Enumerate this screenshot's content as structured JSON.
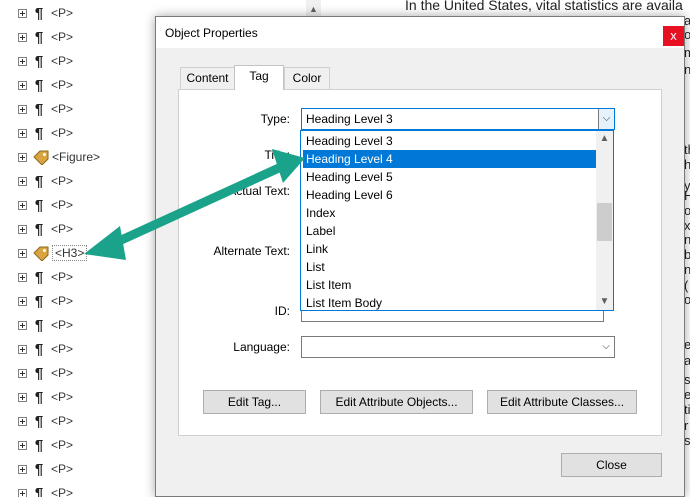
{
  "tree": {
    "items": [
      {
        "type": "p",
        "label": "<P>"
      },
      {
        "type": "p",
        "label": "<P>"
      },
      {
        "type": "p",
        "label": "<P>"
      },
      {
        "type": "p",
        "label": "<P>"
      },
      {
        "type": "p",
        "label": "<P>"
      },
      {
        "type": "p",
        "label": "<P>"
      },
      {
        "type": "tag",
        "label": "<Figure>"
      },
      {
        "type": "p",
        "label": "<P>"
      },
      {
        "type": "p",
        "label": "<P>"
      },
      {
        "type": "p",
        "label": "<P>"
      },
      {
        "type": "tag",
        "label": "<H3>"
      },
      {
        "type": "p",
        "label": "<P>"
      },
      {
        "type": "p",
        "label": "<P>"
      },
      {
        "type": "p",
        "label": "<P>"
      },
      {
        "type": "p",
        "label": "<P>"
      },
      {
        "type": "p",
        "label": "<P>"
      },
      {
        "type": "p",
        "label": "<P>"
      },
      {
        "type": "p",
        "label": "<P>"
      },
      {
        "type": "p",
        "label": "<P>"
      },
      {
        "type": "p",
        "label": "<P>"
      },
      {
        "type": "p",
        "label": "<P>"
      }
    ]
  },
  "document": {
    "text_line": "In the United States, vital statistics are availa",
    "fragments": [
      "a",
      "o",
      "m",
      "n",
      "th",
      "h",
      "y",
      "He",
      "o",
      "xt",
      "n",
      "be",
      "ny",
      "(",
      "or",
      "e",
      "a",
      "s",
      "e",
      "ti",
      "r",
      "s"
    ]
  },
  "dialog": {
    "title": "Object Properties",
    "close_label": "x",
    "tabs": [
      {
        "label": "Content",
        "active": false
      },
      {
        "label": "Tag",
        "active": true
      },
      {
        "label": "Color",
        "active": false
      }
    ],
    "fields": {
      "type_label": "Type:",
      "type_value": "Heading Level 3",
      "title_label": "Title:",
      "actual_text_label": "Actual Text:",
      "alternate_text_label": "Alternate Text:",
      "id_label": "ID:",
      "language_label": "Language:",
      "language_value": ""
    },
    "dropdown_options": [
      {
        "label": "Heading Level 3",
        "highlighted": false
      },
      {
        "label": "Heading Level 4",
        "highlighted": true
      },
      {
        "label": "Heading Level 5",
        "highlighted": false
      },
      {
        "label": "Heading Level 6",
        "highlighted": false
      },
      {
        "label": "Index",
        "highlighted": false
      },
      {
        "label": "Label",
        "highlighted": false
      },
      {
        "label": "Link",
        "highlighted": false
      },
      {
        "label": "List",
        "highlighted": false
      },
      {
        "label": "List Item",
        "highlighted": false
      },
      {
        "label": "List Item Body",
        "highlighted": false
      }
    ],
    "buttons": {
      "edit_tag": "Edit Tag...",
      "edit_attribute_objects": "Edit Attribute Objects...",
      "edit_attribute_classes": "Edit Attribute Classes...",
      "close": "Close"
    }
  },
  "annotation": {
    "arrow_color": "#1aa38a"
  }
}
